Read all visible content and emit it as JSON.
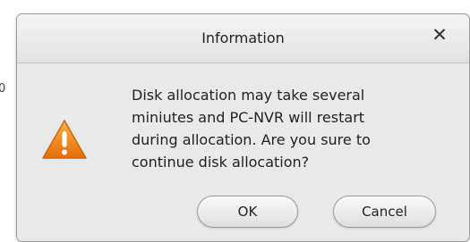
{
  "background": {
    "edge_glyph": "0"
  },
  "dialog": {
    "title": "Information",
    "close_glyph": "✕",
    "icon": "warning-icon",
    "message": "Disk allocation may take several\nminiutes and PC-NVR will restart\nduring allocation. Are you sure to\ncontinue disk allocation?",
    "buttons": {
      "ok_label": "OK",
      "cancel_label": "Cancel"
    },
    "colors": {
      "warning_fill": "#f28a16",
      "warning_stroke": "#ffffff",
      "title_bar": "#ececec",
      "body": "#e9e9e9"
    }
  }
}
